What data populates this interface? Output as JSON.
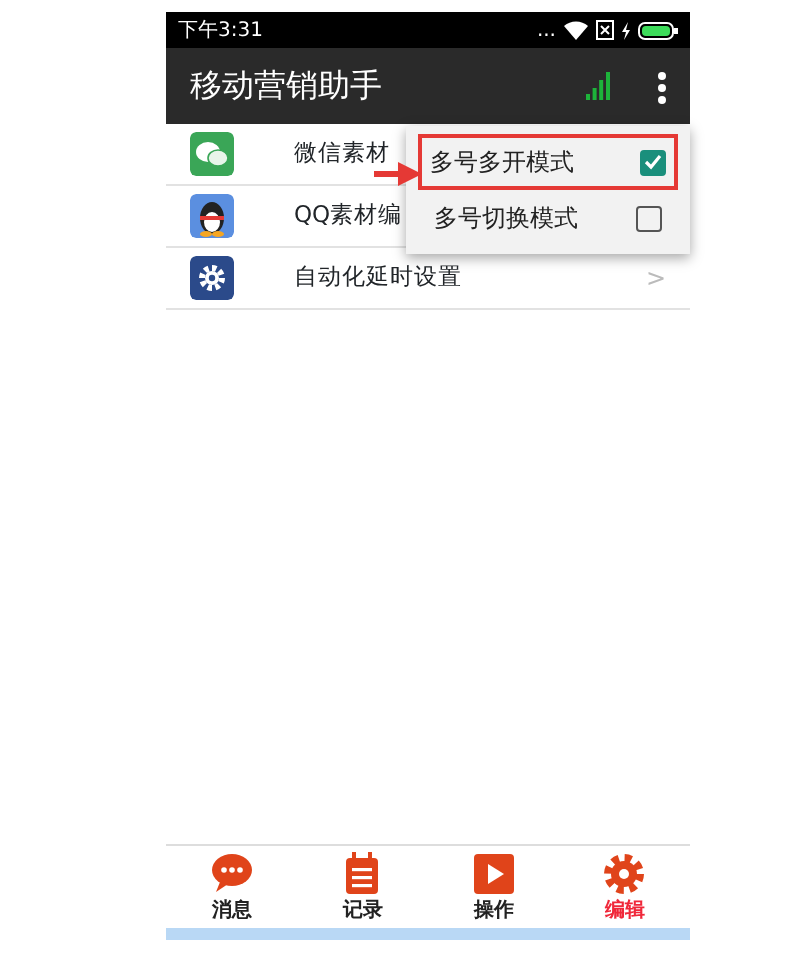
{
  "status_bar": {
    "time": "下午3:31",
    "dots": "..."
  },
  "app_bar": {
    "title": "移动营销助手"
  },
  "list": [
    {
      "kind": "chat",
      "label": "微信素材"
    },
    {
      "kind": "penguin",
      "label": "QQ素材编"
    },
    {
      "kind": "gear",
      "label": "自动化延时设置",
      "chevron": ">"
    }
  ],
  "menu": [
    {
      "label": "多号多开模式",
      "checked": true,
      "highlighted": true
    },
    {
      "label": "多号切换模式",
      "checked": false,
      "highlighted": false
    }
  ],
  "bottom_nav": [
    {
      "label": "消息",
      "selected": false
    },
    {
      "label": "记录",
      "selected": false
    },
    {
      "label": "操作",
      "selected": false
    },
    {
      "label": "编辑",
      "selected": true
    }
  ]
}
